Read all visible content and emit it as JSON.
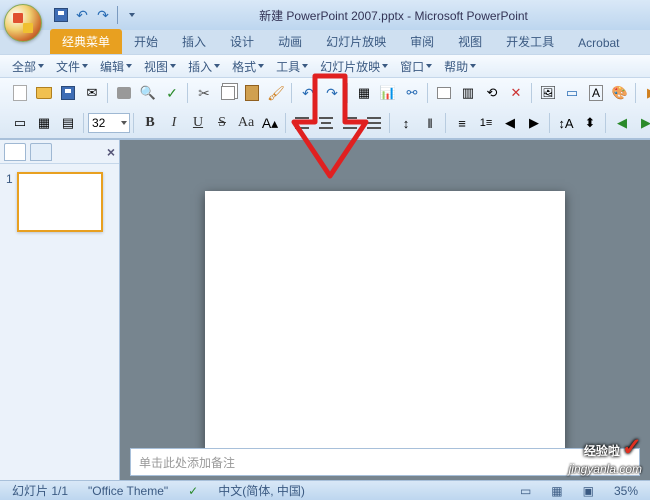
{
  "title": "新建 PowerPoint 2007.pptx - Microsoft PowerPoint",
  "tabs": {
    "classic": "经典菜单",
    "home": "开始",
    "insert": "插入",
    "design": "设计",
    "anim": "动画",
    "slideshow": "幻灯片放映",
    "review": "审阅",
    "view": "视图",
    "dev": "开发工具",
    "acrobat": "Acrobat"
  },
  "menus": {
    "all": "全部",
    "file": "文件",
    "edit": "编辑",
    "view": "视图",
    "insert": "插入",
    "format": "格式",
    "tools": "工具",
    "slideshow": "幻灯片放映",
    "window": "窗口",
    "help": "帮助"
  },
  "toolbar": {
    "font_size": "32",
    "bold": "B",
    "italic": "I",
    "underline": "U",
    "strike": "S",
    "case": "Aa",
    "font_a": "A"
  },
  "side": {
    "thumb_number": "1"
  },
  "notes_placeholder": "单击此处添加备注",
  "status": {
    "slide": "幻灯片 1/1",
    "theme": "\"Office Theme\"",
    "lang": "中文(简体, 中国)",
    "zoom": "35%"
  },
  "watermark": {
    "brand": "经验啦",
    "url": "jingyanla.com"
  }
}
